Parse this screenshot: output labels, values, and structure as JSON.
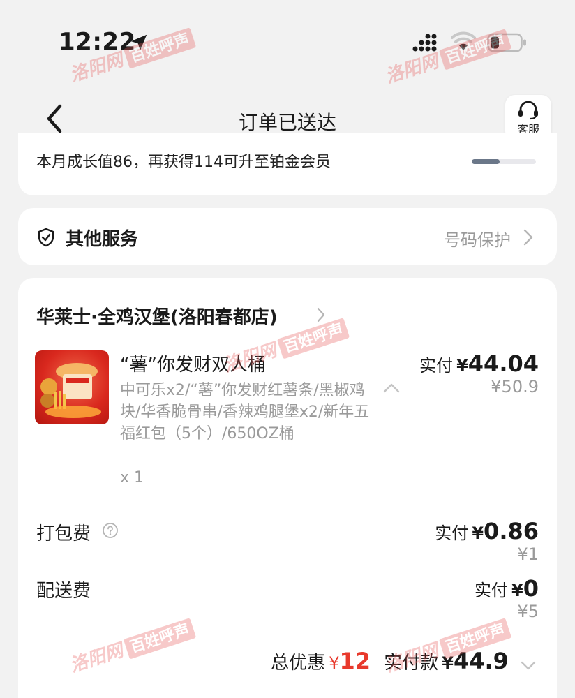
{
  "status_bar": {
    "time": "12:22",
    "location_icon": "location-arrow-icon",
    "signal_icon": "cellular-signal-icon",
    "wifi_icon": "wifi-icon",
    "battery_icon": "battery-icon"
  },
  "nav": {
    "title": "订单已送达",
    "back_icon": "chevron-left-icon",
    "customer_service_label": "客服",
    "customer_service_icon": "headset-icon"
  },
  "growth": {
    "text": "本月成长值86，再获得114可升至铂金会员",
    "progress": 0.43
  },
  "services": {
    "title": "其他服务",
    "right_label": "号码保护",
    "icon": "shield-check-icon"
  },
  "order": {
    "store_name": "华莱士·全鸡汉堡(洛阳春都店)",
    "product": {
      "name": "“薯”你发财双人桶",
      "description": "中可乐x2/“薯”你发财红薯条/黑椒鸡块/华香脆骨串/香辣鸡腿堡x2/新年五福红包（5个）/650OZ桶",
      "quantity": "x 1",
      "paid_label": "实付",
      "paid_currency": "¥",
      "paid_amount": "44.04",
      "original_price": "¥50.9"
    },
    "packing_fee": {
      "label": "打包费",
      "paid_label": "实付",
      "paid_currency": "¥",
      "paid_amount": "0.86",
      "original_price": "¥1"
    },
    "delivery_fee": {
      "label": "配送费",
      "paid_label": "实付",
      "paid_currency": "¥",
      "paid_amount": "0",
      "original_price": "¥5"
    },
    "summary": {
      "discount_label": "总优惠",
      "discount_currency": "¥",
      "discount_amount": "12",
      "total_label": "实付款",
      "total_currency": "¥",
      "total_amount": "44.9"
    }
  },
  "watermark": {
    "site": "洛阳网",
    "tag": "百姓呼声"
  },
  "colors": {
    "background": "#f2f2f2",
    "card": "#ffffff",
    "discount_red": "#e8392c",
    "secondary_text": "#9a9a9a"
  }
}
